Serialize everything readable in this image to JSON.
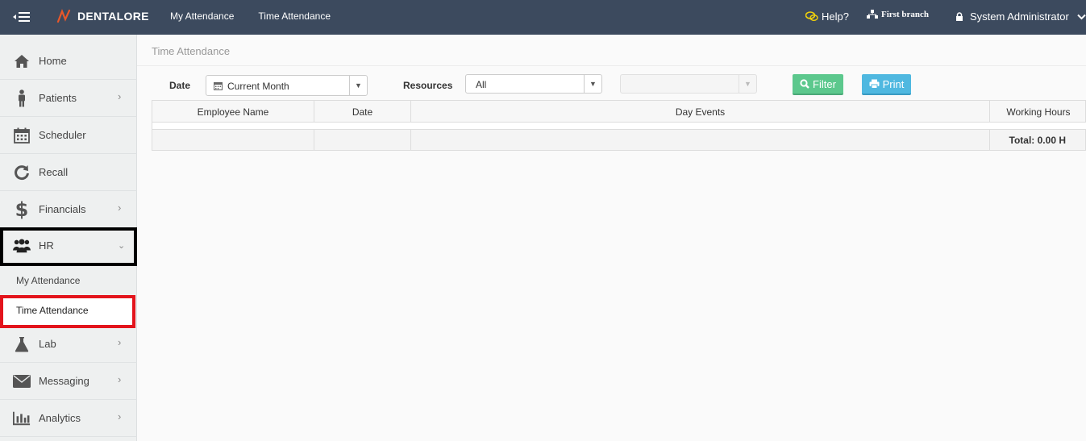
{
  "header": {
    "brand": "DENTALORE",
    "nav": [
      "My Attendance",
      "Time Attendance"
    ],
    "help_label": "Help?",
    "branch_label": "First branch",
    "user_label": "System Administrator"
  },
  "sidebar": {
    "items": [
      {
        "label": "Home",
        "icon": "home-icon"
      },
      {
        "label": "Patients",
        "icon": "person-icon"
      },
      {
        "label": "Scheduler",
        "icon": "calendar-icon"
      },
      {
        "label": "Recall",
        "icon": "refresh-icon"
      },
      {
        "label": "Financials",
        "icon": "dollar-icon"
      },
      {
        "label": "HR",
        "icon": "users-icon"
      },
      {
        "label": "Lab",
        "icon": "flask-icon"
      },
      {
        "label": "Messaging",
        "icon": "envelope-icon"
      },
      {
        "label": "Analytics",
        "icon": "bar-chart-icon"
      }
    ],
    "hr_sub": [
      "My Attendance",
      "Time Attendance"
    ]
  },
  "main": {
    "breadcrumb": "Time Attendance",
    "filters": {
      "date_label": "Date",
      "date_value": "Current Month",
      "resources_label": "Resources",
      "resources_value": "All",
      "filter_button": "Filter",
      "print_button": "Print"
    },
    "table": {
      "columns": [
        "Employee Name",
        "Date",
        "Day Events",
        "Working Hours"
      ],
      "total": "Total: 0.00 H"
    }
  }
}
